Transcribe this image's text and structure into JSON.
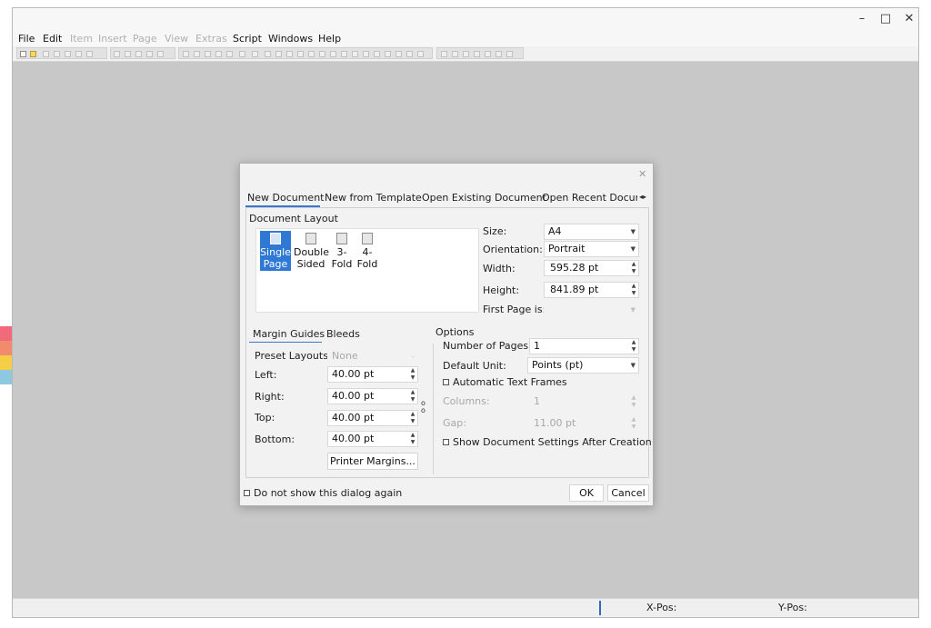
{
  "app": {
    "window_controls": {
      "minimize": "–",
      "maximize": "□",
      "close": "✕"
    },
    "menu": [
      {
        "label": "File",
        "enabled": true
      },
      {
        "label": "Edit",
        "enabled": true
      },
      {
        "label": "Item",
        "enabled": false
      },
      {
        "label": "Insert",
        "enabled": false
      },
      {
        "label": "Page",
        "enabled": false
      },
      {
        "label": "View",
        "enabled": false
      },
      {
        "label": "Extras",
        "enabled": false
      },
      {
        "label": "Script",
        "enabled": true
      },
      {
        "label": "Windows",
        "enabled": true
      },
      {
        "label": "Help",
        "enabled": true
      }
    ],
    "status": {
      "xpos_label": "X-Pos:",
      "ypos_label": "Y-Pos:"
    },
    "palette_colors": [
      "#f06a7c",
      "#f28b6e",
      "#f4cf45",
      "#8ec7e0"
    ]
  },
  "dialog": {
    "close": "✕",
    "tabs": [
      "New Document",
      "New from Template",
      "Open Existing Document",
      "Open Recent Docum"
    ],
    "tab_scroll": "◂▸",
    "layout": {
      "title": "Document Layout",
      "items": [
        {
          "line1": "Single",
          "line2": "Page",
          "selected": true
        },
        {
          "line1": "Double",
          "line2": "Sided",
          "selected": false
        },
        {
          "line1": "3-",
          "line2": "Fold",
          "selected": false
        },
        {
          "line1": "4-",
          "line2": "Fold",
          "selected": false
        }
      ]
    },
    "size": {
      "label": "Size:",
      "value": "A4"
    },
    "orientation": {
      "label": "Orientation:",
      "value": "Portrait"
    },
    "width": {
      "label": "Width:",
      "value": "595.28 pt"
    },
    "height": {
      "label": "Height:",
      "value": "841.89 pt"
    },
    "first_page": {
      "label": "First Page is:",
      "value": ""
    },
    "margin_tabs": [
      "Margin Guides",
      "Bleeds"
    ],
    "preset": {
      "label": "Preset Layouts:",
      "value": "None"
    },
    "margins": {
      "left": {
        "label": "Left:",
        "value": "40.00 pt"
      },
      "right": {
        "label": "Right:",
        "value": "40.00 pt"
      },
      "top": {
        "label": "Top:",
        "value": "40.00 pt"
      },
      "bottom": {
        "label": "Bottom:",
        "value": "40.00 pt"
      }
    },
    "printer_margins": "Printer Margins...",
    "options": {
      "title": "Options",
      "pages": {
        "label": "Number of Pages:",
        "value": "1"
      },
      "unit": {
        "label": "Default Unit:",
        "value": "Points (pt)"
      },
      "auto_frames": {
        "label": "Automatic Text Frames",
        "checked": false
      },
      "columns": {
        "label": "Columns:",
        "value": "1"
      },
      "gap": {
        "label": "Gap:",
        "value": "11.00 pt"
      },
      "show_settings": {
        "label": "Show Document Settings After Creation",
        "checked": false
      }
    },
    "dont_show": {
      "label": "Do not show this dialog again",
      "checked": false
    },
    "ok": "OK",
    "cancel": "Cancel"
  }
}
